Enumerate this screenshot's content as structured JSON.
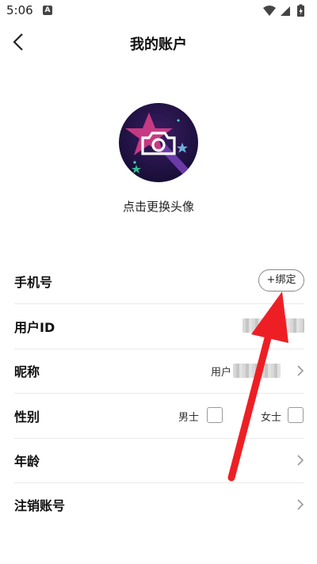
{
  "status_bar": {
    "time": "5:06",
    "notification_icon": "A"
  },
  "header": {
    "title": "我的账户",
    "back_icon": "chevron-left-icon"
  },
  "avatar": {
    "caption": "点击更换头像",
    "icon": "camera-icon"
  },
  "rows": {
    "phone": {
      "label": "手机号",
      "bind_button": "+绑定"
    },
    "user_id": {
      "label": "用户ID"
    },
    "nickname": {
      "label": "昵称",
      "value_prefix": "用户"
    },
    "gender": {
      "label": "性别",
      "male": "男士",
      "female": "女士"
    },
    "age": {
      "label": "年龄"
    },
    "cancel_account": {
      "label": "注销账号"
    }
  },
  "annotation": {
    "color": "#ee1f24"
  }
}
